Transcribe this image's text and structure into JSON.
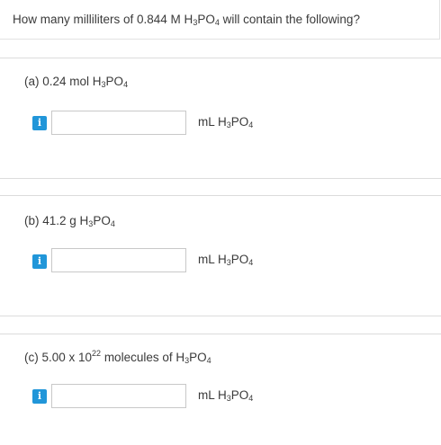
{
  "question": {
    "prefix": "How many milliliters of 0.844 M H",
    "sub1": "3",
    "mid": "PO",
    "sub2": "4",
    "suffix": " will contain the following?"
  },
  "parts": [
    {
      "label_prefix": "(a) 0.24 mol H",
      "label_sub1": "3",
      "label_mid": "PO",
      "label_sub2": "4",
      "answer_value": "",
      "info_label": "i",
      "unit_prefix": "mL H",
      "unit_sub1": "3",
      "unit_mid": "PO",
      "unit_sub2": "4"
    },
    {
      "label_prefix": "(b) 41.2 g H",
      "label_sub1": "3",
      "label_mid": "PO",
      "label_sub2": "4",
      "answer_value": "",
      "info_label": "i",
      "unit_prefix": "mL H",
      "unit_sub1": "3",
      "unit_mid": "PO",
      "unit_sub2": "4"
    },
    {
      "label_prefix": "(c) 5.00 x 10",
      "label_sup": "22",
      "label_after_sup": " molecules of H",
      "label_sub1": "3",
      "label_mid": "PO",
      "label_sub2": "4",
      "answer_value": "",
      "info_label": "i",
      "unit_prefix": "mL H",
      "unit_sub1": "3",
      "unit_mid": "PO",
      "unit_sub2": "4"
    }
  ],
  "colors": {
    "info_button": "#2196d9",
    "text": "#3a3a3a",
    "border": "#dcdcdc"
  }
}
